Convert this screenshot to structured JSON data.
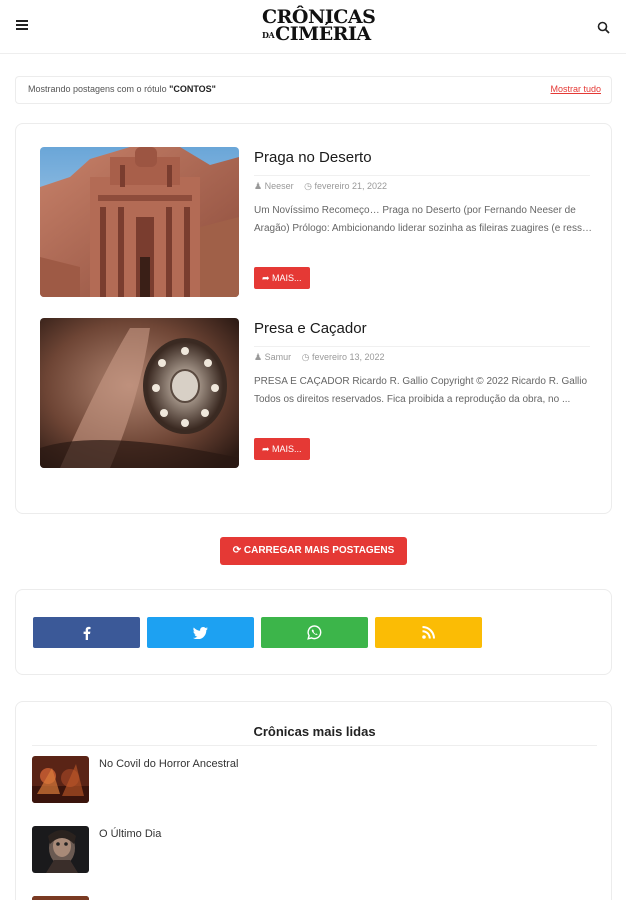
{
  "header": {
    "logo_line1": "CRÔNICAS",
    "logo_small": "DA",
    "logo_line2": "CIMÉRIA",
    "menu_icon": "hamburger-icon",
    "search_icon": "search-icon"
  },
  "label_bar": {
    "prefix": "Mostrando postagens com o rótulo ",
    "label": "\"CONTOS\"",
    "show_all": "Mostrar tudo"
  },
  "posts": [
    {
      "title": "Praga no Deserto",
      "author": "Neeser",
      "date": "fevereiro 21, 2022",
      "excerpt": "Um Novíssimo Recomeço… Praga no Deserto (por Fernando Neeser de Aragão) Prólogo: Ambicionando liderar sozinha as fileiras zuagires (e ress…",
      "more": "MAIS..."
    },
    {
      "title": "Presa e Caçador",
      "author": "Samur",
      "date": "fevereiro 13, 2022",
      "excerpt": "PRESA E CAÇADOR Ricardo R. Gallio Copyright © 2022 Ricardo R. Gallio Todos os direitos reservados. Fica proibida a reprodução da obra, no ...",
      "more": "MAIS..."
    }
  ],
  "load_more": "CARREGAR MAIS POSTAGENS",
  "share": [
    "facebook-icon",
    "twitter-icon",
    "whatsapp-icon",
    "rss-icon"
  ],
  "popular": {
    "title": "Crônicas mais lidas",
    "items": [
      {
        "label": "No Covil do Horror Ancestral"
      },
      {
        "label": "O Último Dia"
      }
    ]
  },
  "colors": {
    "accent": "#e53935",
    "facebook": "#3b5998",
    "twitter": "#1da1f2",
    "whatsapp": "#3cb54a",
    "rss": "#fbbc05"
  }
}
